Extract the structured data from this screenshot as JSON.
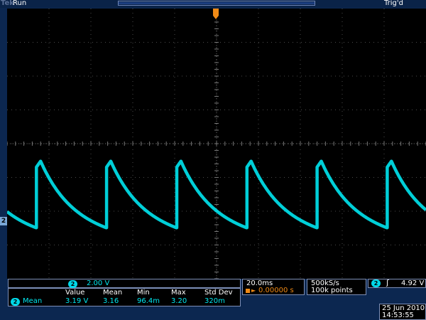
{
  "header": {
    "brand": "Tek",
    "run_status": "Run",
    "trigger_status": "Trig'd"
  },
  "channel_marker": {
    "label": "2"
  },
  "scale": {
    "channel": "2",
    "volts_per_div": "2.00 V"
  },
  "measurement": {
    "channel": "2",
    "name": "Mean",
    "headers": [
      "Value",
      "Mean",
      "Min",
      "Max",
      "Std Dev"
    ],
    "values": [
      "3.19 V",
      "3.16",
      "96.4m",
      "3.20",
      "320m"
    ]
  },
  "timebase": {
    "time_per_div": "20.0ms",
    "trigger_position": "0.00000 s"
  },
  "acquisition": {
    "sample_rate": "500kS/s",
    "record_length": "100k points"
  },
  "trigger": {
    "channel": "2",
    "slope_symbol": "ʃ",
    "level": "4.92 V"
  },
  "datetime": {
    "date": "25 Jun  2010",
    "time": "14:53:55"
  },
  "colors": {
    "trace": "#00e6f0",
    "background": "#0c2750",
    "graticule": "#4a4a4a",
    "trigger_marker": "#f08a16"
  },
  "waveform": {
    "volts_per_div": 2.0,
    "time_per_div_ms": 20.0,
    "period_ms": 33.5,
    "high_start_v": 3.2,
    "peak_v": 3.55,
    "low_end_v": -0.4,
    "first_step_ms": 14.0,
    "vertical_divisions": 8,
    "horizontal_divisions": 10
  }
}
